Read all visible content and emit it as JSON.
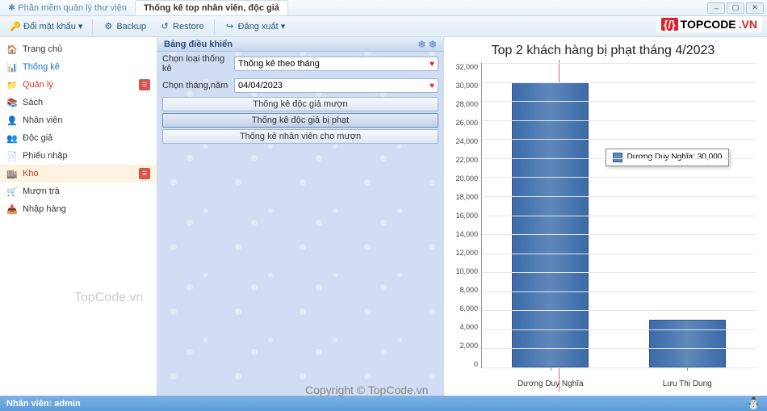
{
  "app": {
    "name": "Phần mềm quản lý thư viện",
    "active_tab": "Thống kê top nhân viên, độc giả"
  },
  "toolbar": {
    "change_pw": "Đổi mật khẩu",
    "backup": "Backup",
    "restore": "Restore",
    "logout": "Đăng xuất"
  },
  "sidebar": [
    {
      "label": "Trang chủ",
      "style": "normal"
    },
    {
      "label": "Thống kê",
      "style": "blue"
    },
    {
      "label": "Quản lý",
      "style": "red",
      "pdf": true
    },
    {
      "label": "Sách",
      "style": "normal"
    },
    {
      "label": "Nhân viên",
      "style": "normal"
    },
    {
      "label": "Độc giả",
      "style": "normal"
    },
    {
      "label": "Phiếu nhập",
      "style": "normal"
    },
    {
      "label": "Kho",
      "style": "red",
      "pdf": true,
      "selected": true
    },
    {
      "label": "Mượn trả",
      "style": "normal"
    },
    {
      "label": "Nhập hàng",
      "style": "normal"
    }
  ],
  "panel": {
    "header": "Bảng điều khiển",
    "type_label": "Chọn loại thống kê",
    "type_value": "Thống kê theo tháng",
    "month_label": "Chọn tháng,năm",
    "month_value": "04/04/2023",
    "btn1": "Thống kê độc giả mượn",
    "btn2": "Thống kê độc giả bị phạt",
    "btn3": "Thống kê nhân viên cho mượn"
  },
  "chart_data": {
    "type": "bar",
    "title": "Top 2 khách hàng bị phạt tháng 4/2023",
    "categories": [
      "Dương Duy Nghĩa",
      "Lưu Thị Dung"
    ],
    "values": [
      30000,
      5000
    ],
    "ylim": [
      0,
      32000
    ],
    "ystep": 2000,
    "tooltip": "Dương Duy Nghĩa: 30,000"
  },
  "status": {
    "user_label": "Nhân viên: admin"
  },
  "branding": {
    "logo1": "TOPCODE",
    "logo2": ".VN",
    "wm1": "TopCode.vn",
    "wm2": "Copyright © TopCode.vn"
  }
}
